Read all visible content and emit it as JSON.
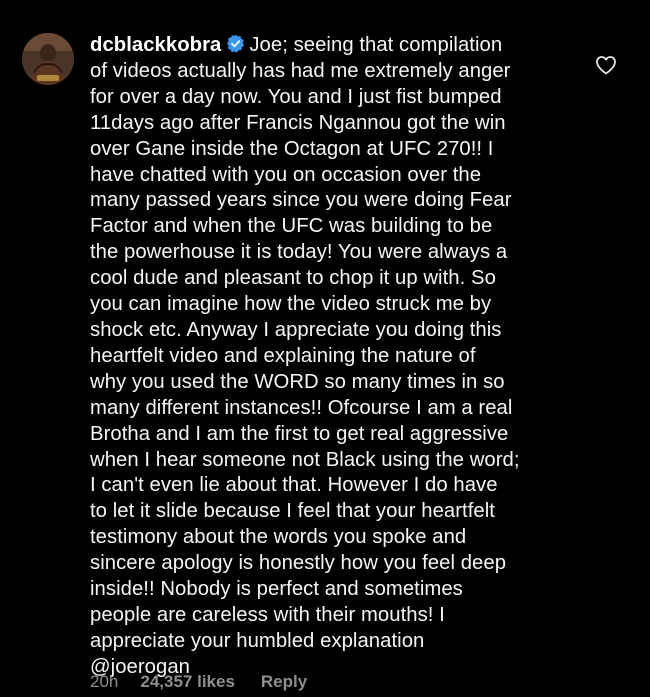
{
  "comment": {
    "username": "dcblackkobra",
    "verified": true,
    "text": "Joe; seeing that compilation\nof videos actually has had me extremely anger\nfor over a day now. You and I just fist bumped\n11days ago after Francis Ngannou got the win\nover Gane inside the Octagon at UFC 270!! I\nhave chatted with you on occasion over the\nmany passed years since you were doing Fear\nFactor and when the UFC was building to be\nthe powerhouse it is today! You were always a\ncool dude and pleasant to chop it up with. So\nyou can imagine how the video struck me by\nshock etc. Anyway I appreciate you doing this\nheartfelt video and explaining the nature of\nwhy you used the WORD so many times in so\nmany different instances!! Ofcourse I am a real\nBrotha and I am the first to get real aggressive\nwhen I hear someone not Black using the word;\nI can't even lie about that. However I do have\nto let it slide because I feel that your heartfelt\ntestimony about the words you spoke and\nsincere apology is honestly how you feel deep\ninside!! Nobody is perfect and sometimes\npeople are careless with their mouths! I\nappreciate your humbled explanation\n@joerogan",
    "timestamp": "20h",
    "likes": "24,357 likes",
    "reply_label": "Reply",
    "icons": {
      "verified": "verified-badge-icon",
      "like": "heart-outline-icon"
    }
  },
  "colors": {
    "background": "#000000",
    "text": "#f5f5f5",
    "muted": "#8e8e8e",
    "verified": "#3897f0"
  }
}
